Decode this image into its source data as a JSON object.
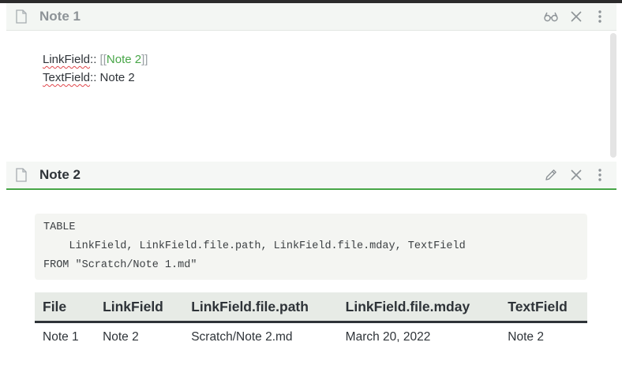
{
  "pane1": {
    "title": "Note 1",
    "lines": [
      {
        "field": "LinkField",
        "sep": ":: ",
        "open": "[[",
        "link": "Note 2",
        "close": "]]"
      },
      {
        "field": "TextField",
        "sep": ":: ",
        "value": "Note 2"
      }
    ],
    "icons": [
      "document-icon",
      "reading-glasses-icon",
      "close-icon",
      "more-vertical-icon"
    ]
  },
  "pane2": {
    "title": "Note 2",
    "icons": [
      "document-icon",
      "edit-pencil-icon",
      "close-icon",
      "more-vertical-icon"
    ],
    "code": [
      "TABLE",
      "    LinkField, LinkField.file.path, LinkField.file.mday, TextField",
      "FROM \"Scratch/Note 1.md\""
    ],
    "table": {
      "headers": [
        "File",
        "LinkField",
        "LinkField.file.path",
        "LinkField.file.mday",
        "TextField"
      ],
      "rows": [
        [
          "Note 1",
          "Note 2",
          "Scratch/Note 2.md",
          "March 20, 2022",
          "Note 2"
        ]
      ]
    }
  },
  "colors": {
    "accent": "#48a648",
    "text": "#2e3338",
    "muted": "#8d9397",
    "header_bg": "#f3f6f3"
  }
}
